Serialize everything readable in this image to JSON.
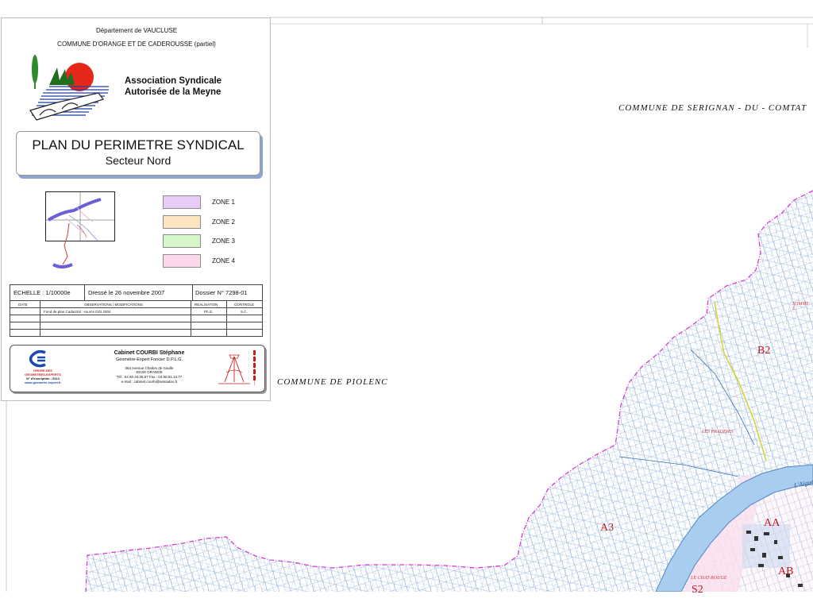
{
  "map": {
    "commune_north": "COMMUNE   DE   SERIGNAN - DU - COMTAT",
    "commune_west": "COMMUNE   DE   PIOLENC",
    "sector_labels": [
      "B2",
      "A3",
      "AA",
      "AB",
      "S2"
    ],
    "place_names": [
      "LES PRADINES",
      "SOMME-L",
      "L'Aigues",
      "LE CHAT-ROUGE"
    ]
  },
  "cartouche": {
    "department": "Département de VAUCLUSE",
    "communes": "COMMUNE D'ORANGE ET DE CADEROUSSE (partiel)",
    "association": [
      "Association Syndicale",
      "Autorisée de la Meyne"
    ],
    "title": "PLAN DU PERIMETRE SYNDICAL",
    "subtitle": "Secteur Nord",
    "legend": [
      {
        "label": "ZONE 1",
        "color": "#e6ccf7"
      },
      {
        "label": "ZONE 2",
        "color": "#fde4c0"
      },
      {
        "label": "ZONE 3",
        "color": "#d6f6c8"
      },
      {
        "label": "ZONE 4",
        "color": "#fcd6ea"
      }
    ],
    "table": {
      "scale": "ECHELLE : 1/10000e",
      "date_drawn": "Dressé le 26 novembre 2007",
      "dossier": "Dossier N° 7298-01",
      "headers": [
        "DATE",
        "OBSERVATIONS / MODIFICATIONS",
        "REALISATION",
        "CONTROLE"
      ],
      "rows": [
        [
          "",
          "Fond de plan Cadastral : source DGI 2004",
          "Ph.G.",
          "S.C."
        ]
      ]
    },
    "cabinet": {
      "name": "Cabinet COURBI Stéphane",
      "title": "Géomètre-Expert Foncier D.P.L.G.",
      "address1": "364 Avenue Charles de Gaulle",
      "address2": "84100 ORANGE",
      "phone": "Tél : 04.90.34.06.57   Fax : 04.90.51.13.77",
      "email": "e-mail : cabinet.courbi@wanadoo.fr",
      "oge": [
        "ORDRE DES",
        "GEOMETRES-EXPERTS",
        "N° d'inscription : 5114"
      ],
      "website": "www.geometre-expert.fr"
    },
    "colors": {
      "accent_red": "#c0141b",
      "parcel_blue": "#5f8fc8",
      "boundary_magenta": "#d43fd3",
      "river_blue": "#9cc4ee"
    }
  }
}
